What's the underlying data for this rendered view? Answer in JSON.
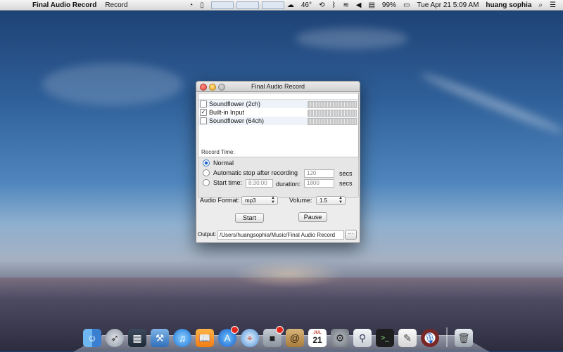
{
  "menubar": {
    "app_name": "Final Audio Record",
    "menus": [
      "Record"
    ],
    "temperature": "46°",
    "battery": "99%",
    "datetime": "Tue Apr 21  5:09 AM",
    "user": "huang sophia"
  },
  "window": {
    "title": "Final Audio Record",
    "devices": [
      {
        "name": "Soundflower (2ch)",
        "checked": false
      },
      {
        "name": "Built-in Input",
        "checked": true
      },
      {
        "name": "Soundflower (64ch)",
        "checked": false
      }
    ],
    "record_time_label": "Record Time:",
    "option_normal": "Normal",
    "option_auto_stop": "Automatic stop after recording",
    "auto_stop_value": "120",
    "secs_label": "secs",
    "option_start_time": "Start time:",
    "start_time_value": "8:30:00",
    "duration_label": "duration:",
    "duration_value": "1800",
    "audio_format_label": "Audio Format:",
    "audio_format_value": "mp3",
    "volume_label": "Volume:",
    "volume_value": "1.5",
    "start_button": "Start",
    "pause_button": "Pause",
    "output_label": "Output:",
    "output_path": "/Users/huangsophia/Music/Final Audio Record",
    "more_button": "···"
  },
  "dock": {
    "calendar_month": "JUL",
    "calendar_day": "21"
  }
}
